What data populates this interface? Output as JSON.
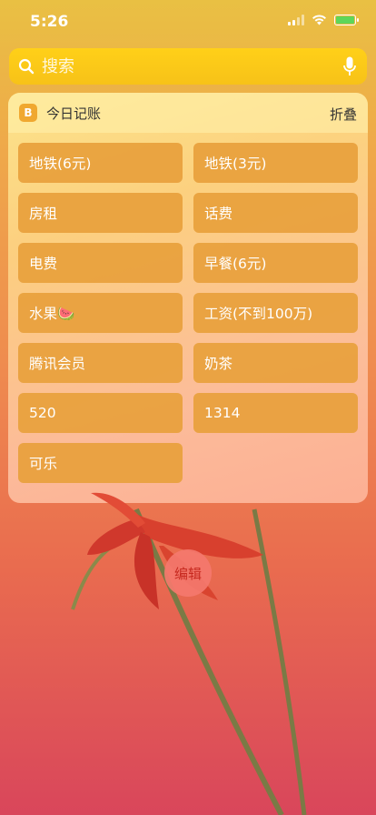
{
  "status": {
    "time": "5:26"
  },
  "search": {
    "placeholder": "搜索"
  },
  "widget": {
    "icon_letter": "B",
    "title": "今日记账",
    "fold_label": "折叠",
    "items": [
      {
        "label": "地铁(6元)"
      },
      {
        "label": "地铁(3元)"
      },
      {
        "label": "房租"
      },
      {
        "label": "话费"
      },
      {
        "label": "电费"
      },
      {
        "label": "早餐(6元)"
      },
      {
        "label": "水果🍉"
      },
      {
        "label": "工资(不到100万)"
      },
      {
        "label": "腾讯会员"
      },
      {
        "label": "奶茶"
      },
      {
        "label": "520"
      },
      {
        "label": "1314"
      },
      {
        "label": "可乐"
      }
    ]
  },
  "edit_label": "编辑"
}
